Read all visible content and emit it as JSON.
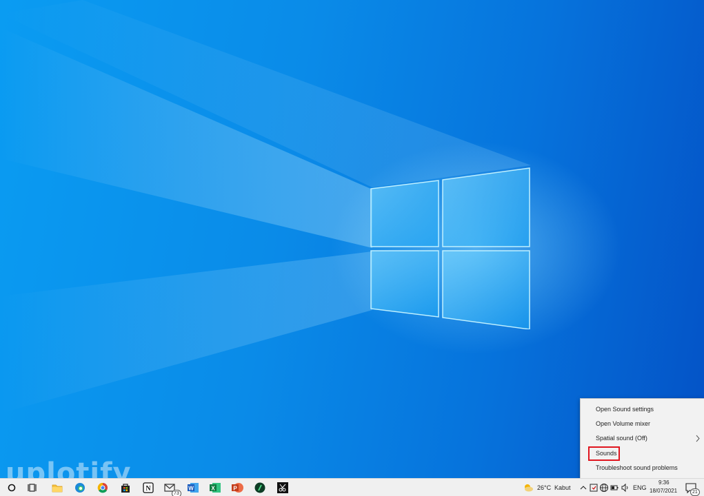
{
  "watermark": "uplotify",
  "context_menu": {
    "items": [
      {
        "label": "Open Sound settings"
      },
      {
        "label": "Open Volume mixer"
      },
      {
        "label": "Spatial sound (Off)",
        "has_submenu": true
      },
      {
        "label": "Sounds",
        "highlighted": true
      },
      {
        "label": "Troubleshoot sound problems"
      }
    ],
    "submenu_icon": "chevron-right-icon",
    "highlight_color": "#e0141e"
  },
  "taskbar": {
    "pinned": [
      {
        "name": "start-button",
        "icon": "cortana-circle-icon"
      },
      {
        "name": "task-view-button",
        "icon": "task-view-icon"
      },
      {
        "name": "file-explorer-button",
        "icon": "folder-icon"
      },
      {
        "name": "edge-button",
        "icon": "edge-icon"
      },
      {
        "name": "chrome-button",
        "icon": "chrome-icon"
      },
      {
        "name": "store-button",
        "icon": "store-bag-icon"
      },
      {
        "name": "notion-button",
        "icon": "notion-icon"
      },
      {
        "name": "mail-button",
        "icon": "mail-icon",
        "badge": "73"
      },
      {
        "name": "word-button",
        "icon": "word-icon"
      },
      {
        "name": "excel-button",
        "icon": "excel-icon"
      },
      {
        "name": "powerpoint-button",
        "icon": "powerpoint-icon"
      },
      {
        "name": "app-button",
        "icon": "green-circle-app-icon"
      },
      {
        "name": "snipping-tool-button",
        "icon": "scissors-icon"
      }
    ],
    "weather": {
      "icon": "weather-sun-cloud-icon",
      "temperature": "26°C",
      "condition": "Kabut"
    },
    "tray": {
      "language": "ENG",
      "time": "9:36",
      "date": "18/07/2021",
      "notification_count": "21"
    }
  }
}
